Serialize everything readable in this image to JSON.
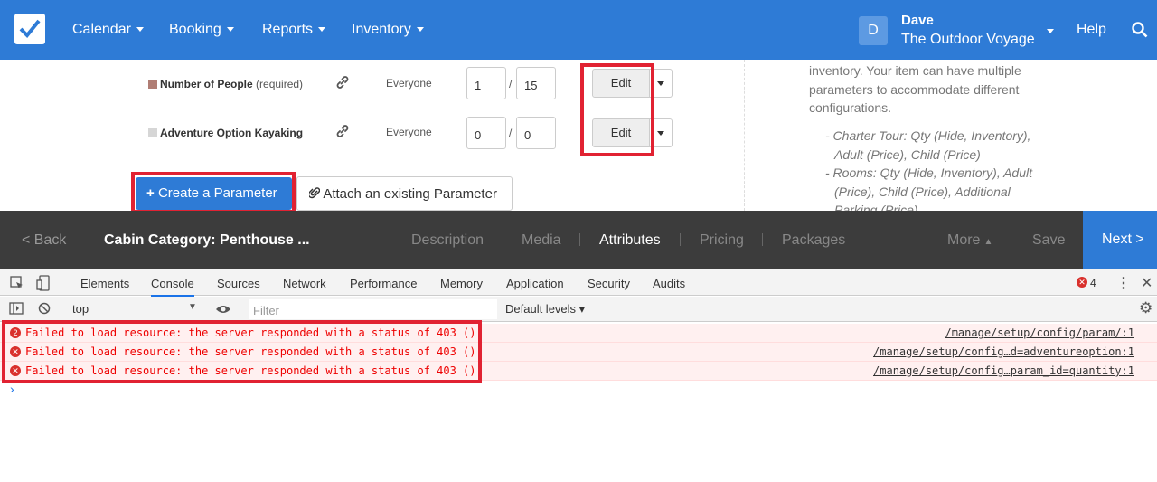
{
  "nav": {
    "items": [
      {
        "label": "Calendar"
      },
      {
        "label": "Booking"
      },
      {
        "label": "Reports"
      },
      {
        "label": "Inventory"
      }
    ],
    "user": {
      "initial": "D",
      "name": "Dave",
      "company": "The Outdoor Voyage"
    },
    "help": "Help"
  },
  "params": [
    {
      "name": "Number of People",
      "required": "(required)",
      "audience": "Everyone",
      "min": "1",
      "max": "15",
      "edit": "Edit",
      "color": "#b07d74"
    },
    {
      "name": "Adventure Option Kayaking",
      "required": "",
      "audience": "Everyone",
      "min": "0",
      "max": "0",
      "edit": "Edit",
      "color": "#d6d6d6"
    }
  ],
  "actions": {
    "create": "Create a Parameter",
    "attach": "Attach an existing Parameter"
  },
  "help_panel": {
    "intro": "inventory. Your item can have multiple parameters to accommodate different configurations.",
    "examples": [
      "- Charter Tour: Qty (Hide, Inventory), Adult (Price), Child (Price)",
      "- Rooms: Qty (Hide, Inventory), Adult (Price), Child (Price), Additional Parking (Price)"
    ]
  },
  "bottom_bar": {
    "back": "< Back",
    "title": "Cabin Category: Penthouse ...",
    "tabs": [
      "Description",
      "Media",
      "Attributes",
      "Pricing",
      "Packages"
    ],
    "active_tab": "Attributes",
    "more": "More",
    "save": "Save",
    "next": "Next >"
  },
  "devtools": {
    "tabs": [
      "Elements",
      "Console",
      "Sources",
      "Network",
      "Performance",
      "Memory",
      "Application",
      "Security",
      "Audits"
    ],
    "active_tab": "Console",
    "error_count": "4",
    "context": "top",
    "filter_placeholder": "Filter",
    "levels": "Default levels ▾",
    "messages": [
      {
        "count": "2",
        "text": "Failed to load resource: the server responded with a status of 403 ()",
        "source": "/manage/setup/config/param/:1"
      },
      {
        "count": "",
        "text": "Failed to load resource: the server responded with a status of 403 ()",
        "source": "/manage/setup/config…d=adventureoption:1"
      },
      {
        "count": "",
        "text": "Failed to load resource: the server responded with a status of 403 ()",
        "source": "/manage/setup/config…param_id=quantity:1"
      }
    ],
    "prompt": "›"
  },
  "colors": {
    "nav_bg": "#2e7bd6",
    "highlight": "#e12232",
    "bar_bg": "#3c3c3c",
    "error_text": "#e00000"
  }
}
